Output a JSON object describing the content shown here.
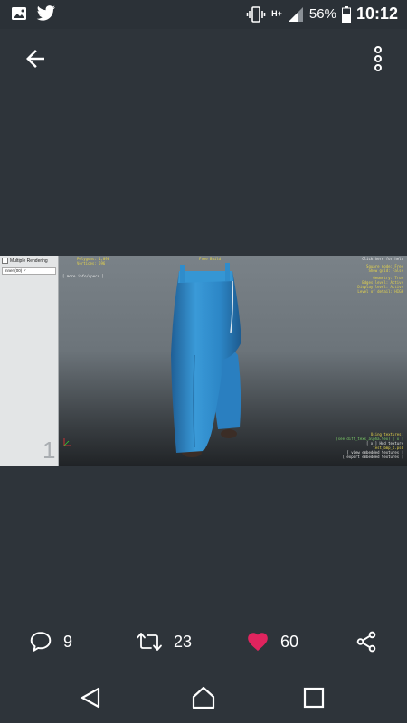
{
  "status_bar": {
    "left_icons": [
      "image-icon",
      "twitter-icon"
    ],
    "network_label": "H+",
    "battery_percent": "56%",
    "time": "10:12",
    "battery_level": 0.56
  },
  "toolbar": {
    "back_icon": "arrow-left-icon",
    "menu_icon": "more-vert-icon"
  },
  "media": {
    "panel_title": "Multiple Rendering",
    "panel_field": "inner (00) ✓",
    "panel_number": "1",
    "hud": {
      "top_center": "Free Build",
      "top_left_1": "Polygons: 1,090",
      "top_left_2": "Vertices: 596",
      "top_left_3": "[ more info/specs ]",
      "top_right_1": "Click here for help",
      "top_right_2": "Square mode: Free",
      "top_right_3": "Show grid: False",
      "right_1": "Geometry: True",
      "right_2": "Edges level: Active",
      "right_3": "Display level: Active",
      "right_4": "Level of detail: HIGH",
      "bottom_right_1": "Using textures:",
      "bottom_right_2": "(see diff_texs_alpha.tex) [ x ]",
      "bottom_right_3": "[ x ] Hdd texture",
      "bottom_right_4": "test_bmp_t.psd",
      "bottom_right_5": "[ view embedded textures ]",
      "bottom_right_6": "[ export embedded textures ]"
    }
  },
  "actions": {
    "reply_count": "9",
    "retweet_count": "23",
    "like_count": "60",
    "like_color": "#e0245e"
  },
  "navbar": {
    "back_icon": "nav-back-icon",
    "home_icon": "nav-home-icon",
    "recents_icon": "nav-recents-icon"
  }
}
